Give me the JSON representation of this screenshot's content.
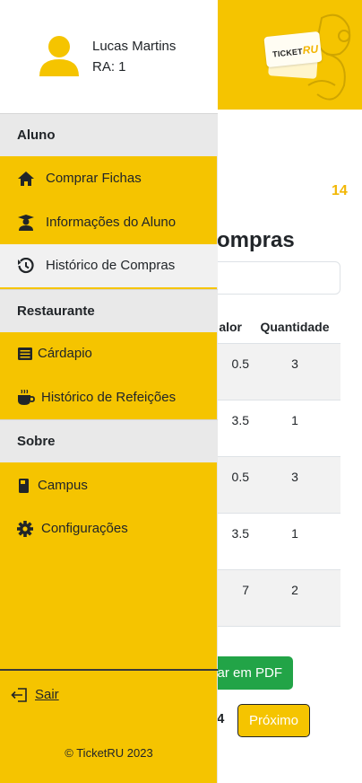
{
  "app": {
    "logo_text_a": "TICKET",
    "logo_text_b": "RU"
  },
  "page": {
    "badge_count": "14",
    "title_fragment": "ompras",
    "table": {
      "headers": [
        "alor",
        "Quantidade"
      ],
      "rows": [
        {
          "valor": "0.5",
          "quantidade": "3"
        },
        {
          "valor": "3.5",
          "quantidade": "1"
        },
        {
          "valor": "0.5",
          "quantidade": "3"
        },
        {
          "valor": "3.5",
          "quantidade": "1"
        },
        {
          "valor": "7",
          "quantidade": "2"
        }
      ]
    },
    "pdf_button": "ar em PDF",
    "page_number": "4",
    "next_button": "Próximo"
  },
  "sidebar": {
    "user": {
      "name": "Lucas Martins",
      "ra": "RA: 1"
    },
    "sections": [
      {
        "title": "Aluno",
        "items": [
          {
            "label": "Comprar Fichas",
            "icon": "home-icon"
          },
          {
            "label": "Informações do Aluno",
            "icon": "graduate-user-icon"
          },
          {
            "label": "Histórico de Compras",
            "icon": "history-icon",
            "active": true
          }
        ]
      },
      {
        "title": "Restaurante",
        "items": [
          {
            "label": "Cárdapio",
            "icon": "menu-list-icon"
          },
          {
            "label": "Histórico de Refeições",
            "icon": "coffee-cup-icon"
          }
        ]
      },
      {
        "title": "Sobre",
        "items": [
          {
            "label": "Campus",
            "icon": "book-icon"
          },
          {
            "label": "Configurações",
            "icon": "gear-icon"
          }
        ]
      }
    ],
    "logout": "Sair",
    "footer": "© TicketRU 2023"
  },
  "colors": {
    "brand_yellow": "#f5c400",
    "accent_yellow_text": "#f2b705",
    "pdf_green": "#22a447",
    "section_grey": "#e9e9e9",
    "active_item": "#f1f1f1"
  }
}
